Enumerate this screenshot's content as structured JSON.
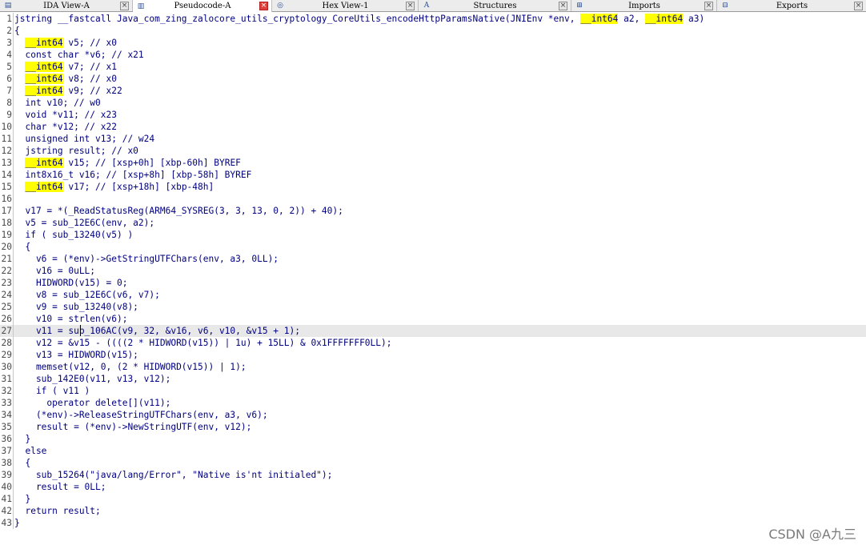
{
  "tabs": [
    {
      "label": "IDA View-A",
      "icon": "ida-view-icon",
      "active": false
    },
    {
      "label": "Pseudocode-A",
      "icon": "pseudocode-icon",
      "active": true
    },
    {
      "label": "Hex View-1",
      "icon": "hex-view-icon",
      "active": false
    },
    {
      "label": "Structures",
      "icon": "structures-icon",
      "active": false
    },
    {
      "label": "Imports",
      "icon": "imports-icon",
      "active": false
    },
    {
      "label": "Exports",
      "icon": "exports-icon",
      "active": false
    }
  ],
  "code": {
    "highlighted_line": 27,
    "lines": [
      {
        "num": "1",
        "text": "jstring __fastcall Java_com_zing_zalocore_utils_cryptology_CoreUtils_encodeHttpParamsNative(JNIEnv *env, __int64 a2, __int64 a3)"
      },
      {
        "num": "2",
        "text": "{"
      },
      {
        "num": "3",
        "text": "  __int64 v5; // x0"
      },
      {
        "num": "4",
        "text": "  const char *v6; // x21"
      },
      {
        "num": "5",
        "text": "  __int64 v7; // x1"
      },
      {
        "num": "6",
        "text": "  __int64 v8; // x0"
      },
      {
        "num": "7",
        "text": "  __int64 v9; // x22"
      },
      {
        "num": "8",
        "text": "  int v10; // w0"
      },
      {
        "num": "9",
        "text": "  void *v11; // x23"
      },
      {
        "num": "10",
        "text": "  char *v12; // x22"
      },
      {
        "num": "11",
        "text": "  unsigned int v13; // w24"
      },
      {
        "num": "12",
        "text": "  jstring result; // x0"
      },
      {
        "num": "13",
        "text": "  __int64 v15; // [xsp+0h] [xbp-60h] BYREF"
      },
      {
        "num": "14",
        "text": "  int8x16_t v16; // [xsp+8h] [xbp-58h] BYREF"
      },
      {
        "num": "15",
        "text": "  __int64 v17; // [xsp+18h] [xbp-48h]"
      },
      {
        "num": "16",
        "text": ""
      },
      {
        "num": "17",
        "text": "  v17 = *(_ReadStatusReg(ARM64_SYSREG(3, 3, 13, 0, 2)) + 40);"
      },
      {
        "num": "18",
        "text": "  v5 = sub_12E6C(env, a2);"
      },
      {
        "num": "19",
        "text": "  if ( sub_13240(v5) )"
      },
      {
        "num": "20",
        "text": "  {"
      },
      {
        "num": "21",
        "text": "    v6 = (*env)->GetStringUTFChars(env, a3, 0LL);"
      },
      {
        "num": "22",
        "text": "    v16 = 0uLL;"
      },
      {
        "num": "23",
        "text": "    HIDWORD(v15) = 0;"
      },
      {
        "num": "24",
        "text": "    v8 = sub_12E6C(v6, v7);"
      },
      {
        "num": "25",
        "text": "    v9 = sub_13240(v8);"
      },
      {
        "num": "26",
        "text": "    v10 = strlen(v6);"
      },
      {
        "num": "27",
        "text": "    v11 = sub_106AC(v9, 32, &v16, v6, v10, &v15 + 1);"
      },
      {
        "num": "28",
        "text": "    v12 = &v15 - ((((2 * HIDWORD(v15)) | 1u) + 15LL) & 0x1FFFFFFF0LL);"
      },
      {
        "num": "29",
        "text": "    v13 = HIDWORD(v15);"
      },
      {
        "num": "30",
        "text": "    memset(v12, 0, (2 * HIDWORD(v15)) | 1);"
      },
      {
        "num": "31",
        "text": "    sub_142E0(v11, v13, v12);"
      },
      {
        "num": "32",
        "text": "    if ( v11 )"
      },
      {
        "num": "33",
        "text": "      operator delete[](v11);"
      },
      {
        "num": "34",
        "text": "    (*env)->ReleaseStringUTFChars(env, a3, v6);"
      },
      {
        "num": "35",
        "text": "    result = (*env)->NewStringUTF(env, v12);"
      },
      {
        "num": "36",
        "text": "  }"
      },
      {
        "num": "37",
        "text": "  else"
      },
      {
        "num": "38",
        "text": "  {"
      },
      {
        "num": "39",
        "text": "    sub_15264(\"java/lang/Error\", \"Native is'nt initialed\");"
      },
      {
        "num": "40",
        "text": "    result = 0LL;"
      },
      {
        "num": "41",
        "text": "  }"
      },
      {
        "num": "42",
        "text": "  return result;"
      },
      {
        "num": "43",
        "text": "}"
      }
    ]
  },
  "watermark": "CSDN @A九三",
  "colors": {
    "highlight_yellow": "#ffff00",
    "code_text": "#000080",
    "current_line": "#e8e8e8",
    "close_active": "#e0403a"
  }
}
